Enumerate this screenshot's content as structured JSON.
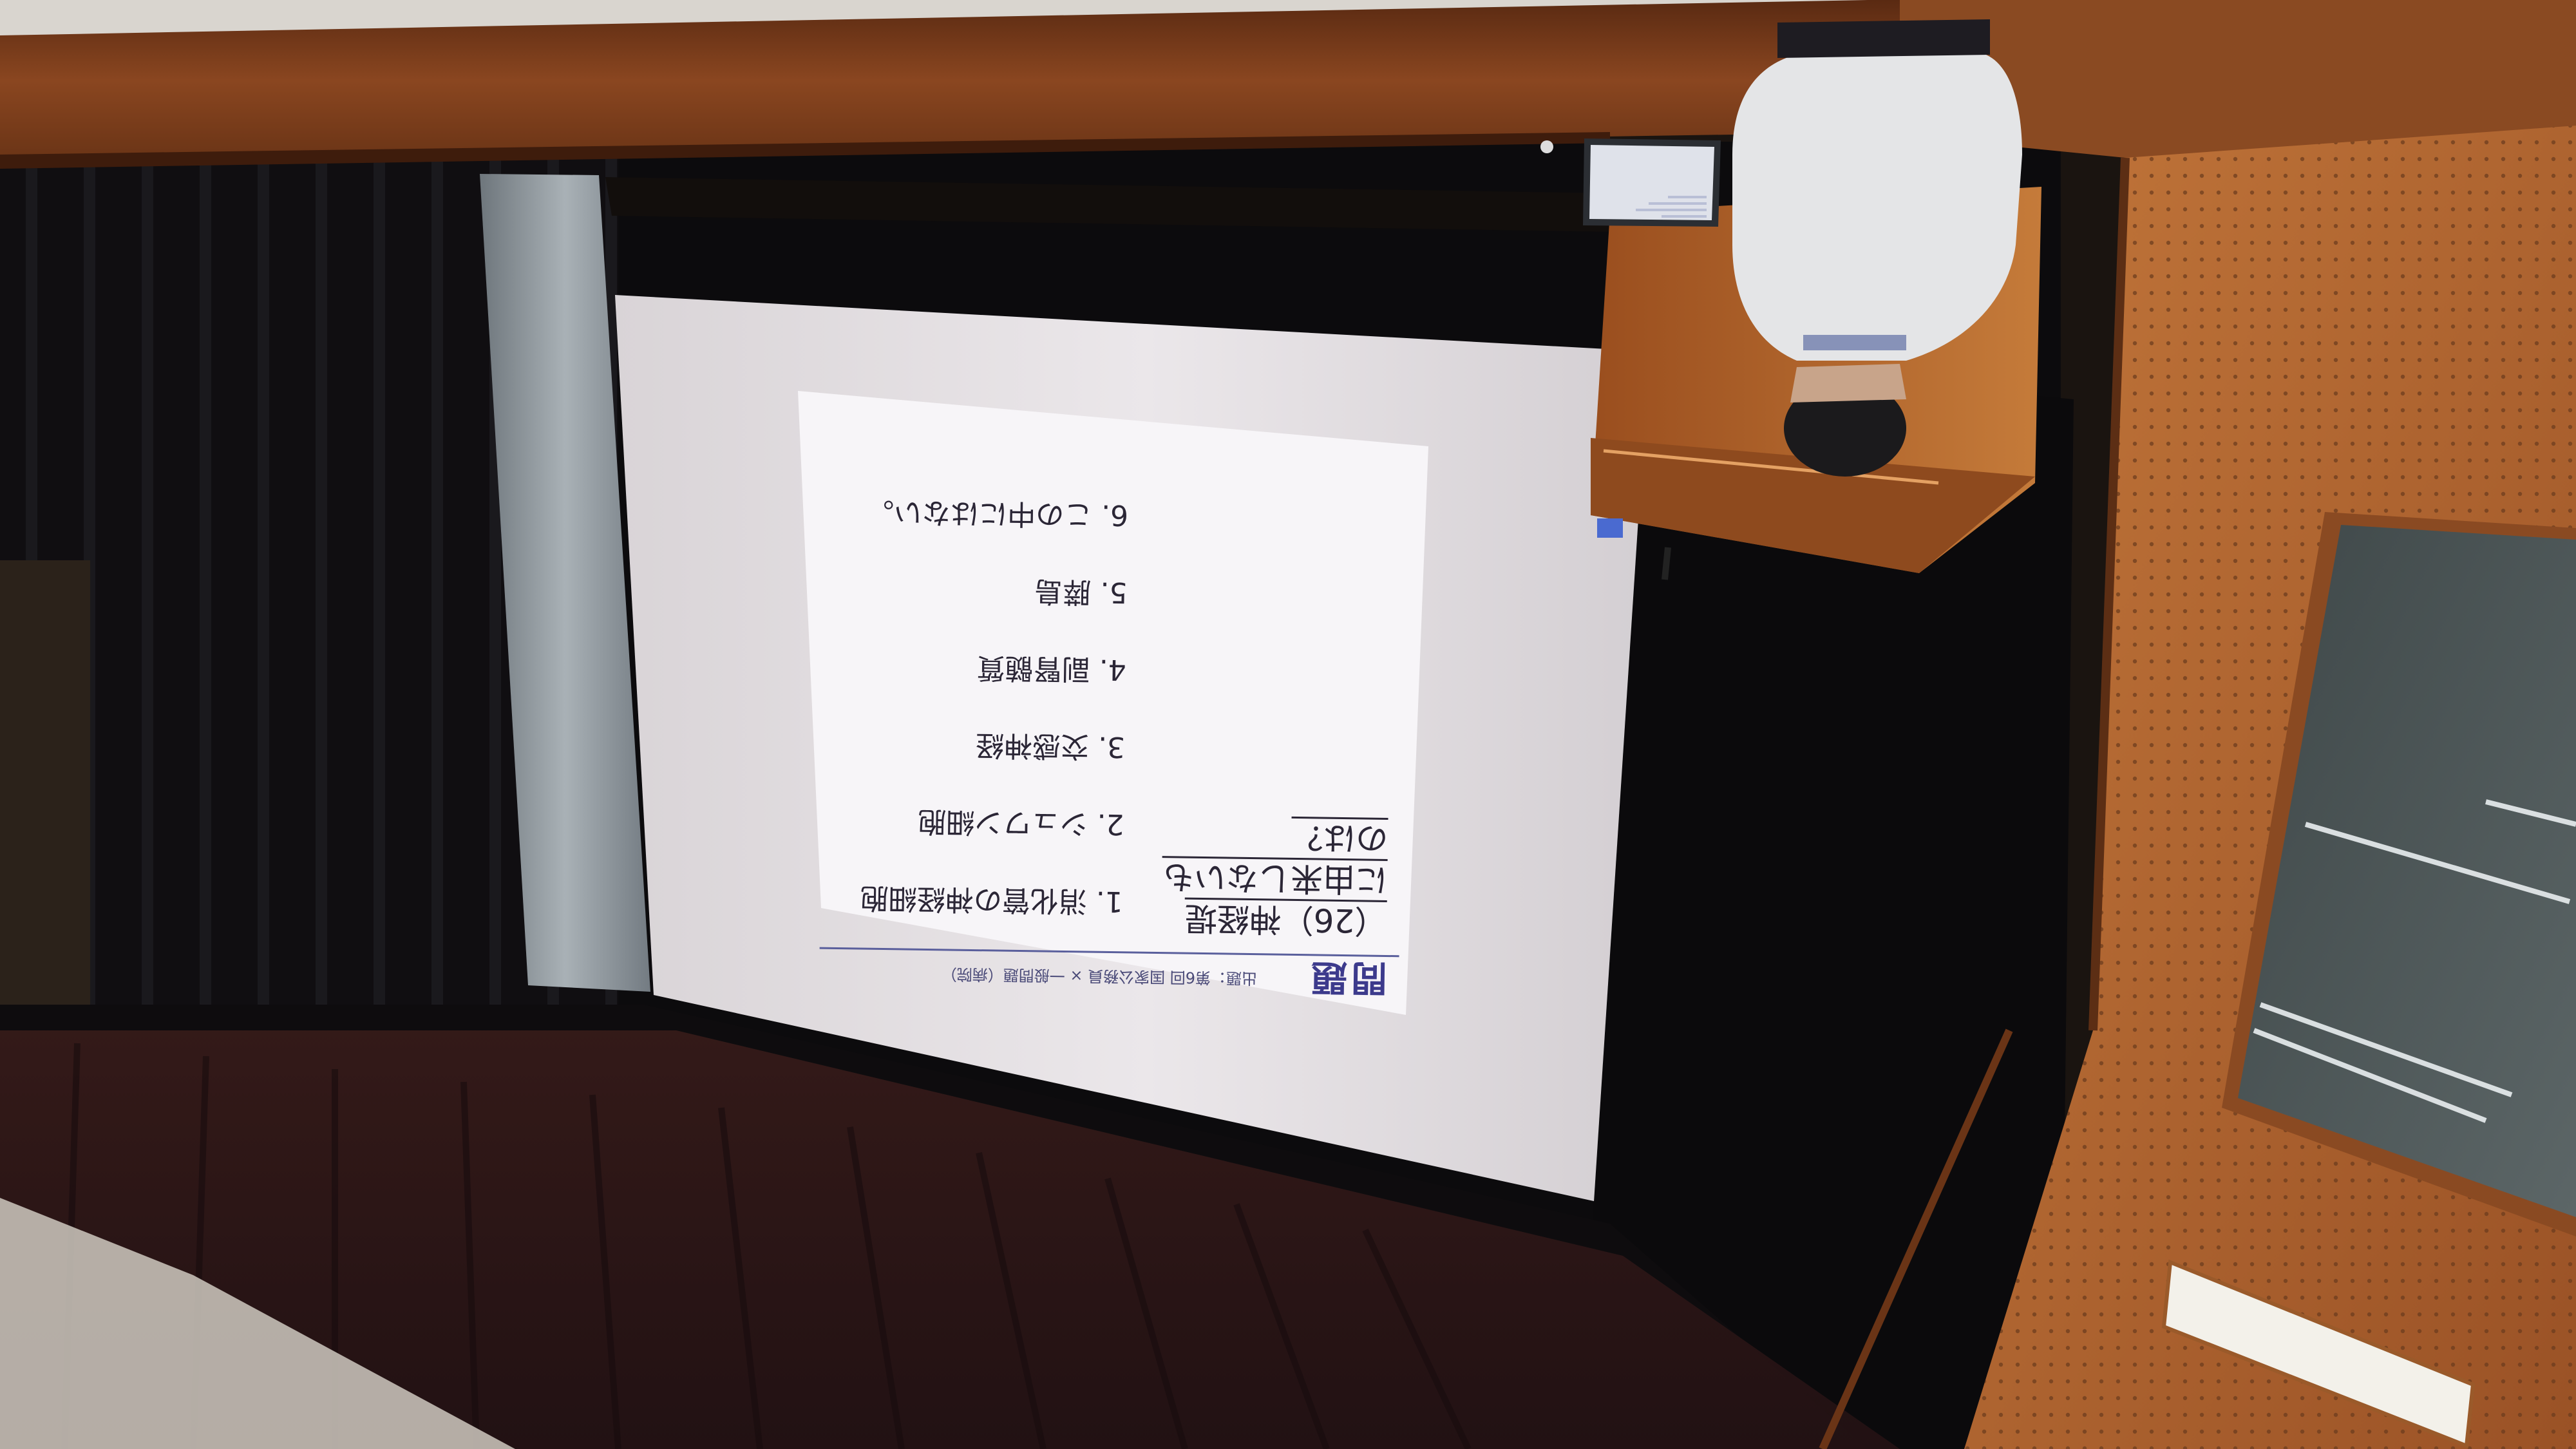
{
  "slide": {
    "title": "問題",
    "source": "出題：第6回 国家公務員 × 一般問題（病院）",
    "question": "（26）神経堤に由来しないものは？",
    "options": [
      "1. 消化管の神経細胞",
      "2. シュワン細胞",
      "3. 交感神経",
      "4. 副腎髄質",
      "5. 膵島",
      "6. この中にはない。"
    ]
  },
  "colors": {
    "wood_beam": "#7a3e1e",
    "wood_panel": "#b5662c",
    "screen": "#e8e4e6",
    "slide_bg": "#f6f4f7",
    "curtain": "#0e0d10",
    "sheer_curtain": "#8e969c",
    "podium": "#b4642a",
    "slide_title": "#3c3a8c"
  }
}
